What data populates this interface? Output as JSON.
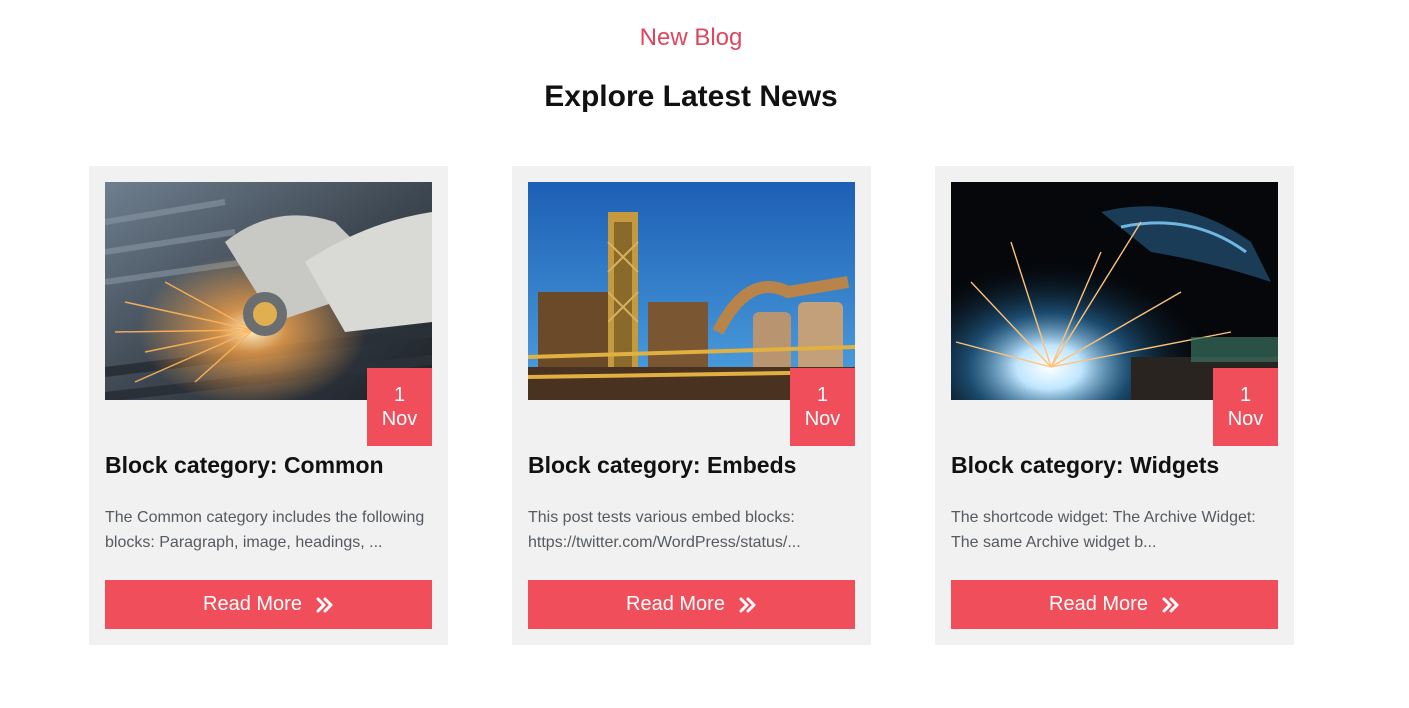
{
  "section": {
    "eyebrow": "New Blog",
    "heading": "Explore Latest News"
  },
  "colors": {
    "accent": "#f04e5a",
    "eyebrow": "#e0455e",
    "card_bg": "#f1f1f1"
  },
  "posts": [
    {
      "image_icon": "angle-grinder-sparks-photo",
      "date_day": "1",
      "date_month": "Nov",
      "title": "Block category: Common",
      "excerpt": "The Common category includes the following blocks: Paragraph, image, headings, ...",
      "button_label": "Read More",
      "button_icon": "double-chevron-right-icon"
    },
    {
      "image_icon": "steel-plant-photo",
      "date_day": "1",
      "date_month": "Nov",
      "title": "Block category: Embeds",
      "excerpt": "This post tests various embed blocks: https://twitter.com/WordPress/status/...",
      "button_label": "Read More",
      "button_icon": "double-chevron-right-icon"
    },
    {
      "image_icon": "welding-sparks-photo",
      "date_day": "1",
      "date_month": "Nov",
      "title": "Block category: Widgets",
      "excerpt": "The shortcode widget: The Archive Widget: The same Archive widget b...",
      "button_label": "Read More",
      "button_icon": "double-chevron-right-icon"
    }
  ]
}
